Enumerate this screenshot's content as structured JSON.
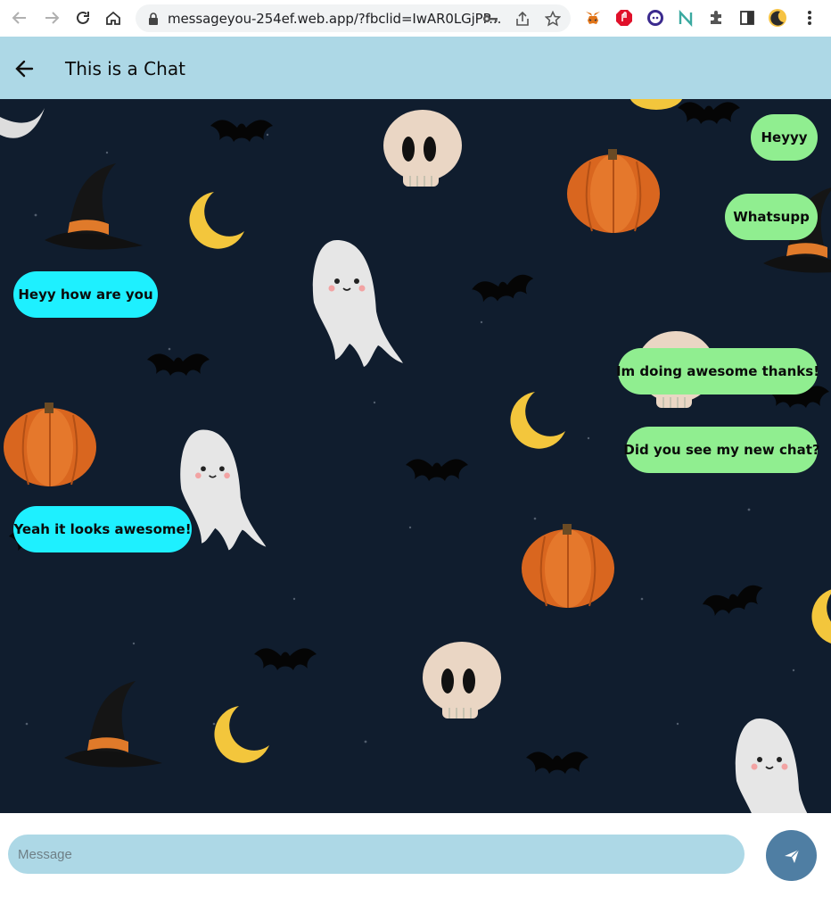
{
  "browser": {
    "url": "messageyou-254ef.web.app/?fbclid=IwAR0LGjPP..."
  },
  "header": {
    "title": "This is a Chat"
  },
  "messages": [
    {
      "text": "Heyyy",
      "direction": "sent"
    },
    {
      "text": "Whatsupp",
      "direction": "sent"
    },
    {
      "text": "Heyy how are you",
      "direction": "received"
    },
    {
      "text": "Im doing awesome thanks!",
      "direction": "sent"
    },
    {
      "text": "Did you see my new chat?",
      "direction": "sent"
    },
    {
      "text": "Yeah it looks awesome!",
      "direction": "received"
    }
  ],
  "composer": {
    "placeholder": "Message",
    "value": ""
  },
  "colors": {
    "appbar": "#add8e6",
    "received_bubble": "#1ef0ff",
    "sent_bubble": "#90ee90",
    "chat_background": "#101d2e",
    "send_button": "#4f7ea3"
  }
}
